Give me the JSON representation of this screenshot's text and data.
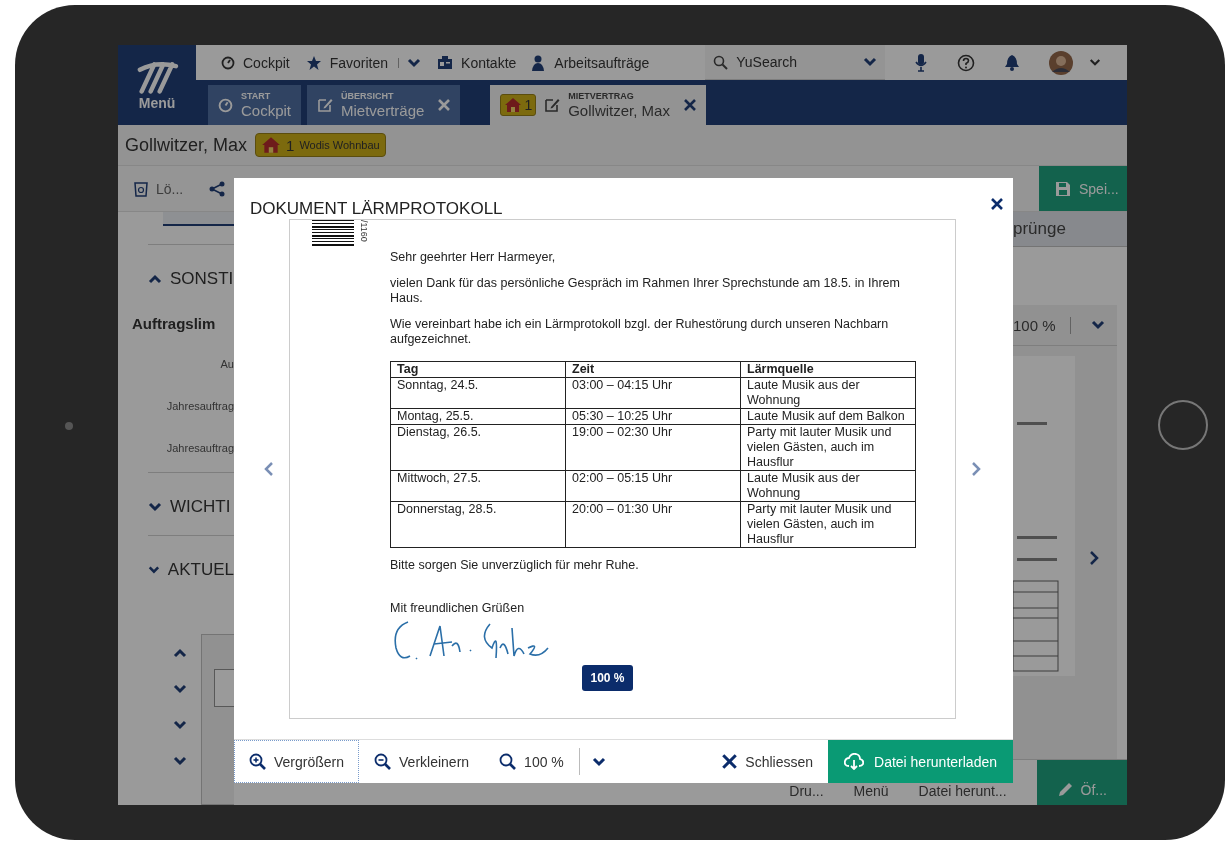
{
  "nav": {
    "menu_label": "Menü",
    "items": [
      {
        "label": "Cockpit",
        "kind": "cockpit",
        "dropdown": false
      },
      {
        "label": "Favoriten",
        "kind": "star",
        "dropdown": true
      },
      {
        "label": "Kontakte",
        "kind": "contacts",
        "dropdown": false
      },
      {
        "label": "Arbeitsaufträge",
        "kind": "worker",
        "dropdown": false
      }
    ],
    "search": {
      "value": "YuSearch"
    }
  },
  "tabs": [
    {
      "caption": "START",
      "label": "Cockpit",
      "kind": "cockpit",
      "selected": false,
      "closable": false
    },
    {
      "caption": "ÜBERSICHT",
      "label": "Mietverträge",
      "kind": "edit",
      "selected": false,
      "closable": true
    },
    {
      "caption": "MIETVERTRAG",
      "label": "Gollwitzer, Max",
      "kind": "edit",
      "selected": true,
      "closable": true,
      "badge": "1"
    }
  ],
  "record": {
    "name": "Gollwitzer, Max",
    "badge_count": "1",
    "badge_label": "Wodis Wohnbau"
  },
  "toolbar": {
    "delete_label": "Lö...",
    "save_label": "Spei..."
  },
  "sections": [
    {
      "title": "SONSTI",
      "expanded": true,
      "fields": [
        {
          "label": "Auftragslim",
          "kind": "heading"
        },
        {
          "label": "Au",
          "kind": "label"
        },
        {
          "label": "Jahresauftrag",
          "kind": "label"
        },
        {
          "label": "Jahresauftrag",
          "kind": "label"
        }
      ]
    },
    {
      "title": "WICHTI",
      "expanded": false
    },
    {
      "title": "AKTUEL",
      "expanded": false
    }
  ],
  "right_panel": {
    "tab_label": "prünge",
    "zoom": "100 %"
  },
  "bottom_bar": [
    {
      "label": "Dru...",
      "kind": "print"
    },
    {
      "label": "Menü",
      "kind": "menu"
    },
    {
      "label": "Datei herunt...",
      "kind": "download"
    },
    {
      "label": "Öf...",
      "kind": "primary"
    }
  ],
  "dialog": {
    "title": "DOKUMENT LÄRMPROTOKOLL",
    "document": {
      "ref": "/1160",
      "greeting": "Sehr geehrter Herr Harmeyer,",
      "paragraphs": [
        "vielen Dank für das persönliche Gespräch im Rahmen Ihrer Sprechstunde am 18.5. in Ihrem Haus.",
        "Wie vereinbart habe ich ein Lärmprotokoll bzgl. der Ruhestörung durch unseren Nachbarn aufgezeichnet."
      ],
      "table": {
        "columns": [
          "Tag",
          "Zeit",
          "Lärmquelle"
        ],
        "rows": [
          [
            "Sonntag, 24.5.",
            "03:00 – 04:15 Uhr",
            "Laute Musik aus der Wohnung"
          ],
          [
            "Montag, 25.5.",
            "05:30 – 10:25 Uhr",
            "Laute Musik auf dem Balkon"
          ],
          [
            "Dienstag, 26.5.",
            "19:00 – 02:30 Uhr",
            "Party mit lauter Musik und vielen Gästen, auch im Hausflur"
          ],
          [
            "Mittwoch, 27.5.",
            "02:00 – 05:15 Uhr",
            "Laute Musik aus der Wohnung"
          ],
          [
            "Donnerstag, 28.5.",
            "20:00 – 01:30 Uhr",
            "Party mit lauter Musik und vielen Gästen, auch im Hausflur"
          ]
        ]
      },
      "request": "Bitte sorgen Sie unverzüglich für mehr Ruhe.",
      "closing": "Mit freundlichen Grüßen",
      "zoom_badge": "100 %"
    },
    "toolbar": [
      {
        "kind": "zoom-in",
        "label": "Vergrößern",
        "selected": true
      },
      {
        "kind": "zoom-out",
        "label": "Verkleinern",
        "selected": false
      },
      {
        "kind": "zoom",
        "label": "100 %",
        "selected": false
      }
    ],
    "close_label": "Schliessen",
    "download_label": "Datei herunterladen"
  }
}
